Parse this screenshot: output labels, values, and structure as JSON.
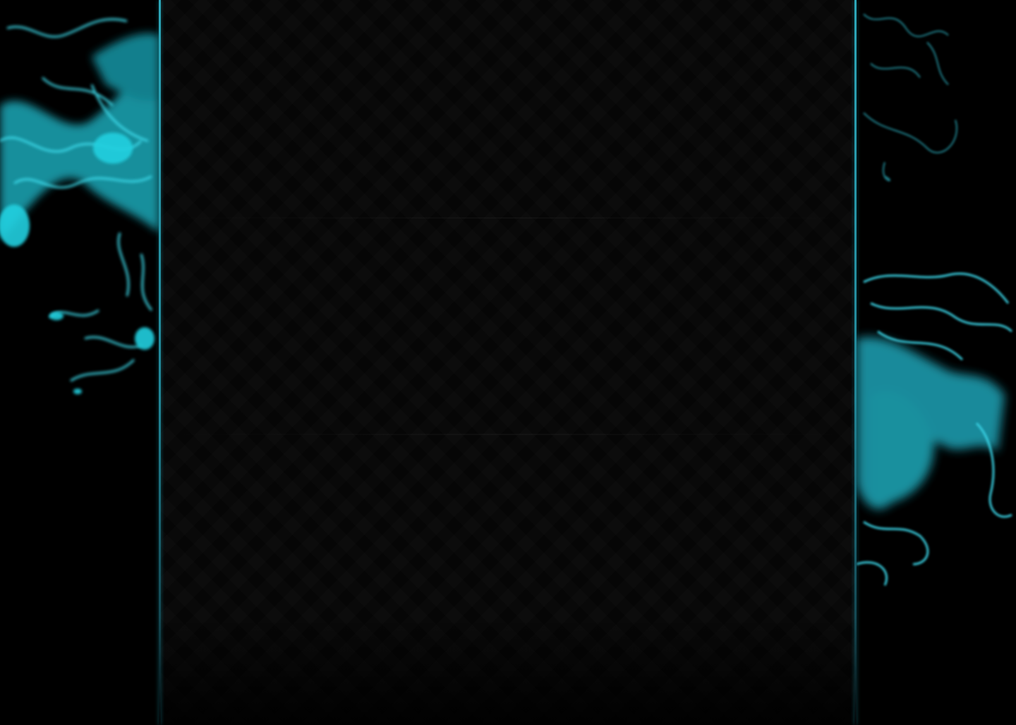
{
  "theme": {
    "background": "#000000",
    "panel_background": "#060606",
    "accent": "#2ca6b8",
    "smoke_color": "#20c8dc"
  }
}
